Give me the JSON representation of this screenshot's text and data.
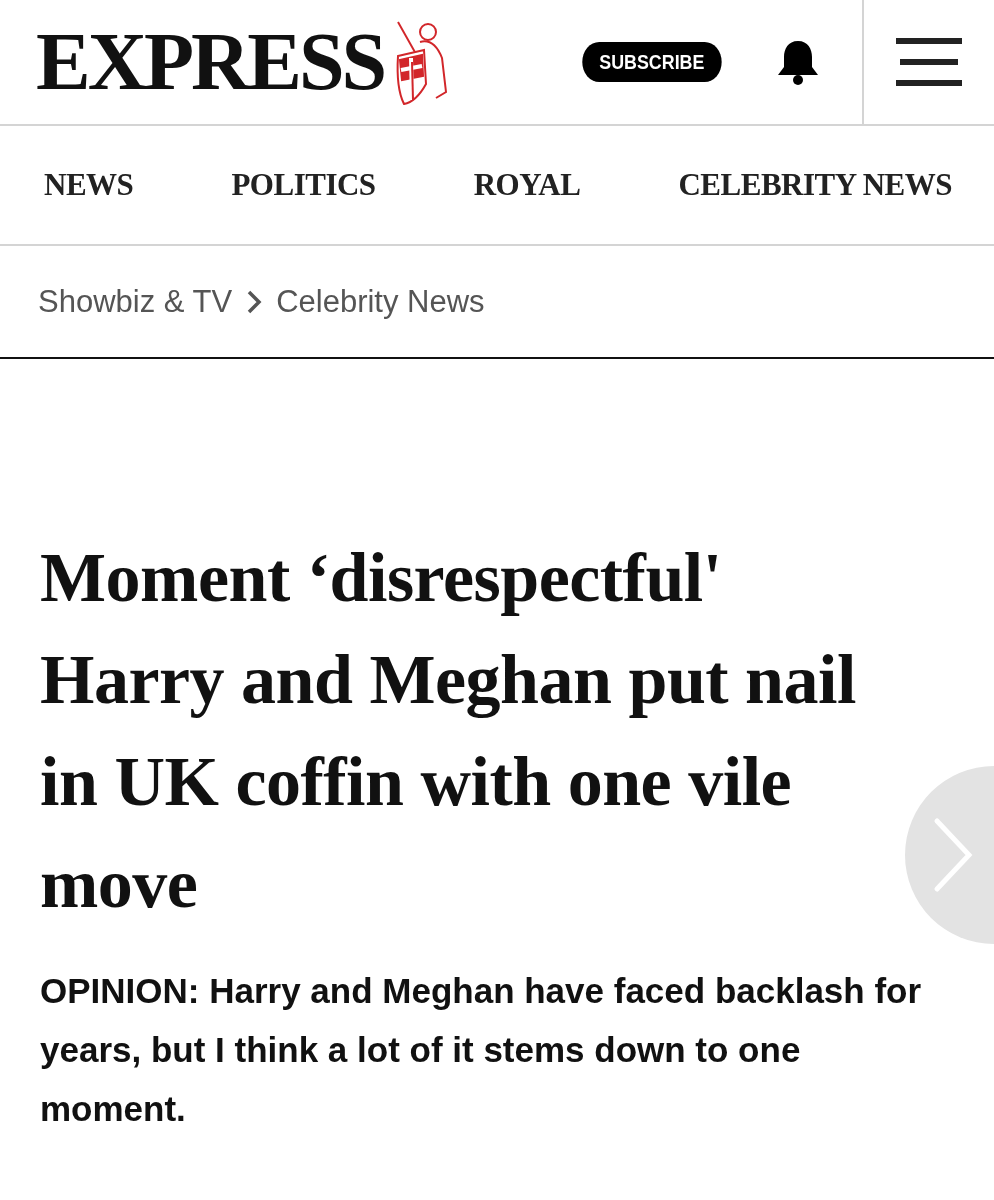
{
  "header": {
    "logo": "EXPRESS",
    "subscribe": "SUBSCRIBE"
  },
  "nav": [
    {
      "label": "NEWS"
    },
    {
      "label": "POLITICS"
    },
    {
      "label": "ROYAL"
    },
    {
      "label": "CELEBRITY NEWS"
    }
  ],
  "breadcrumb": [
    "Showbiz & TV",
    "Celebrity News"
  ],
  "article": {
    "headline": "Moment ‘disrespectful' Harry and Meghan put nail in UK coffin with one vile move",
    "standfirst": "OPINION: Harry and Meghan have faced backlash for years, but I think a lot of it stems down to one moment."
  }
}
